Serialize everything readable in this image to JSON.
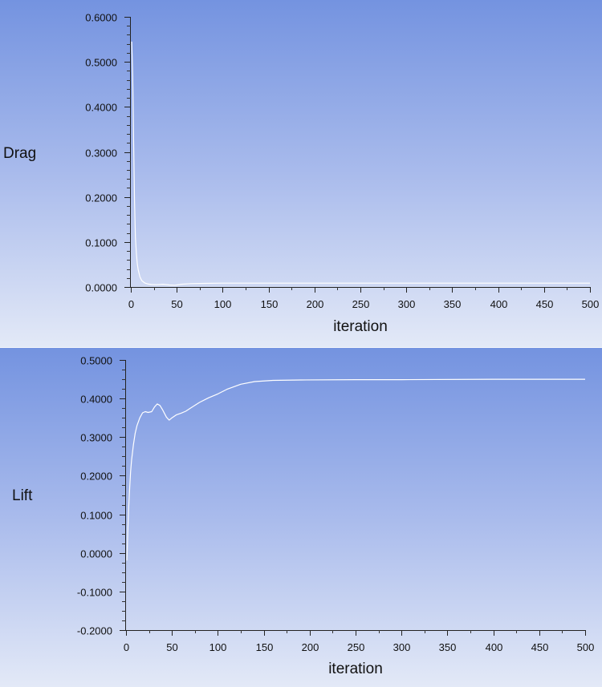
{
  "chart_data": [
    {
      "type": "line",
      "title": "",
      "xlabel": "iteration",
      "ylabel": "Drag",
      "xlim": [
        0,
        500
      ],
      "ylim": [
        0.0,
        0.6
      ],
      "xticks": [
        "0",
        "50",
        "100",
        "150",
        "200",
        "250",
        "300",
        "350",
        "400",
        "450",
        "500"
      ],
      "yticks": [
        "0.0000",
        "0.1000",
        "0.2000",
        "0.3000",
        "0.4000",
        "0.5000",
        "0.6000"
      ],
      "grid": false,
      "series": [
        {
          "name": "Drag",
          "color": "#ffffff",
          "x": [
            1,
            2,
            3,
            4,
            5,
            6,
            7,
            8,
            10,
            12,
            15,
            18,
            22,
            28,
            35,
            42,
            48,
            55,
            65,
            80,
            100,
            150,
            200,
            300,
            400,
            500
          ],
          "y": [
            0.545,
            0.47,
            0.33,
            0.19,
            0.11,
            0.075,
            0.052,
            0.038,
            0.022,
            0.014,
            0.009,
            0.007,
            0.0055,
            0.005,
            0.006,
            0.0045,
            0.004,
            0.006,
            0.0075,
            0.008,
            0.0085,
            0.0085,
            0.0085,
            0.0085,
            0.0085,
            0.0085
          ]
        }
      ]
    },
    {
      "type": "line",
      "title": "",
      "xlabel": "iteration",
      "ylabel": "Lift",
      "xlim": [
        0,
        500
      ],
      "ylim": [
        -0.2,
        0.5
      ],
      "xticks": [
        "0",
        "50",
        "100",
        "150",
        "200",
        "250",
        "300",
        "350",
        "400",
        "450",
        "500"
      ],
      "yticks": [
        "-0.2000",
        "-0.1000",
        "0.0000",
        "0.1000",
        "0.2000",
        "0.3000",
        "0.4000",
        "0.5000"
      ],
      "grid": false,
      "series": [
        {
          "name": "Lift",
          "color": "#ffffff",
          "x": [
            1,
            2,
            3,
            4,
            5,
            6,
            8,
            10,
            12,
            15,
            18,
            21,
            24,
            28,
            31,
            34,
            37,
            40,
            44,
            47,
            50,
            55,
            60,
            65,
            70,
            80,
            90,
            100,
            110,
            125,
            140,
            160,
            190,
            250,
            300,
            400,
            500
          ],
          "y": [
            -0.02,
            0.06,
            0.12,
            0.17,
            0.21,
            0.24,
            0.28,
            0.31,
            0.33,
            0.35,
            0.363,
            0.366,
            0.364,
            0.366,
            0.378,
            0.386,
            0.382,
            0.37,
            0.352,
            0.344,
            0.35,
            0.358,
            0.362,
            0.367,
            0.375,
            0.39,
            0.402,
            0.412,
            0.424,
            0.437,
            0.444,
            0.447,
            0.448,
            0.449,
            0.449,
            0.45,
            0.45
          ]
        }
      ]
    }
  ]
}
